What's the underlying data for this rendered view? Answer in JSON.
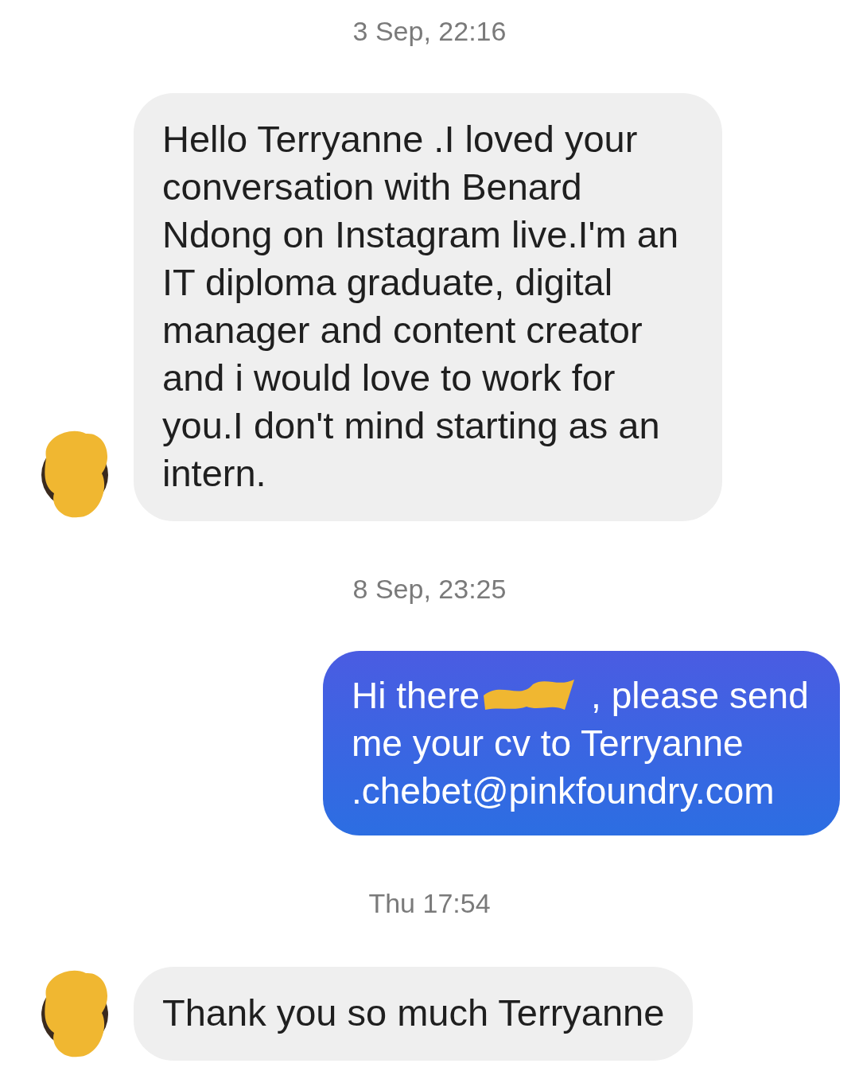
{
  "messages": [
    {
      "kind": "timestamp",
      "text": "3 Sep, 22:16"
    },
    {
      "kind": "incoming",
      "text": "Hello Terryanne .I loved your conversation with Benard Ndong on Instagram live.I'm an IT diploma graduate,  digital manager and content creator and i would love to work for you.I don't mind starting as an intern.",
      "avatar": true
    },
    {
      "kind": "timestamp",
      "text": "8 Sep, 23:25"
    },
    {
      "kind": "outgoing",
      "text_before": "Hi there",
      "text_after": ", please send me your cv to Terryanne .chebet@pinkfoundry.com",
      "redacted": true
    },
    {
      "kind": "timestamp",
      "text": "Thu 17:54"
    },
    {
      "kind": "incoming",
      "text": "Thank you so much Terryanne",
      "avatar": true
    }
  ]
}
